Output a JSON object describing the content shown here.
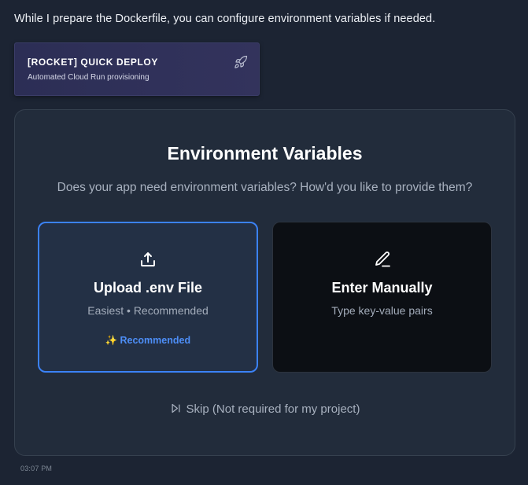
{
  "message": {
    "intro": "While I prepare the Dockerfile, you can configure environment variables if needed.",
    "timestamp": "03:07 PM"
  },
  "deploy_card": {
    "title": "[ROCKET] QUICK DEPLOY",
    "subtitle": "Automated Cloud Run provisioning",
    "icon": "rocket-icon"
  },
  "env_panel": {
    "title": "Environment Variables",
    "question": "Does your app need environment variables? How'd you like to provide them?",
    "options": [
      {
        "title": "Upload .env File",
        "subtitle": "Easiest • Recommended",
        "badge_icon": "✨",
        "badge": "Recommended",
        "icon": "upload-icon",
        "selected": true
      },
      {
        "title": "Enter Manually",
        "subtitle": "Type key-value pairs",
        "icon": "pencil-icon",
        "selected": false
      }
    ],
    "skip_label": "Skip (Not required for my project)",
    "skip_icon": "skip-forward-icon"
  },
  "colors": {
    "accent": "#3b82f6",
    "background": "#1c2433",
    "panel": "#222c3b",
    "badge_spark": "#f4c04c"
  }
}
